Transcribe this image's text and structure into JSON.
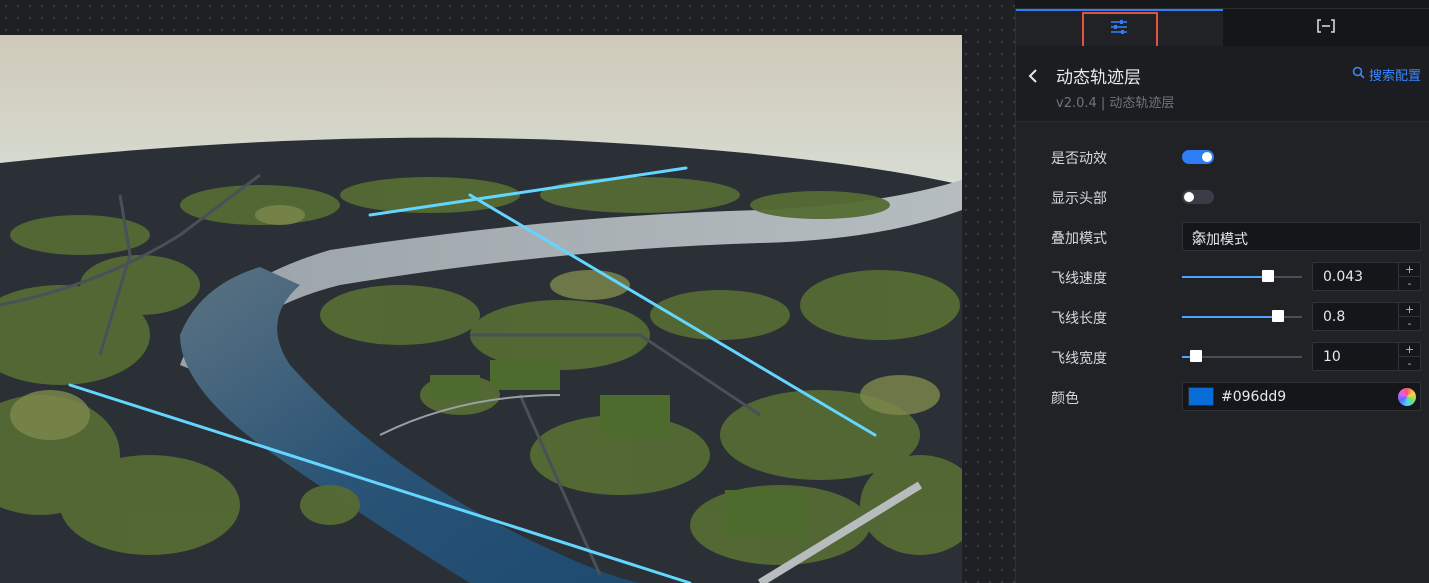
{
  "panel": {
    "tabs": [
      {
        "icon": "sliders-icon"
      },
      {
        "icon": "bracket-icon"
      }
    ],
    "title": "动态轨迹层",
    "subtitle": "v2.0.4 | 动态轨迹层",
    "search_label": "搜索配置"
  },
  "settings": {
    "animate": {
      "label": "是否动效",
      "on": true
    },
    "show_head": {
      "label": "显示头部",
      "on": false
    },
    "blend_mode": {
      "label": "叠加模式",
      "value": "添加模式"
    },
    "speed": {
      "label": "飞线速度",
      "value": "0.043",
      "level": 0.72
    },
    "length": {
      "label": "飞线长度",
      "value": "0.8",
      "level": 0.8
    },
    "width": {
      "label": "飞线宽度",
      "value": "10",
      "level": 0.12
    },
    "color": {
      "label": "颜色",
      "value": "#096dd9"
    }
  },
  "colors": {
    "accent": "#2f7df6",
    "highlight": "#e2523c",
    "trail": "#63d6ff"
  }
}
